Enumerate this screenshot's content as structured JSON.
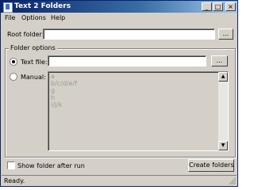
{
  "window": {
    "title": "Text 2 Folders"
  },
  "titlebar": {
    "minimize": "_",
    "maximize": "□",
    "close": "×"
  },
  "menu": {
    "file": "File",
    "options": "Options",
    "help": "Help"
  },
  "root_folder": {
    "label": "Root folder:",
    "value": "",
    "browse": "..."
  },
  "folder_options": {
    "title": "Folder options",
    "text_file": {
      "label": "Text file:",
      "value": "",
      "selected": true,
      "browse": "..."
    },
    "manual": {
      "label": "Manual:",
      "selected": false,
      "lines": [
        "a",
        "b/c/d/e/f",
        "g",
        "h",
        "i/j/k"
      ]
    }
  },
  "show_folder_after_run": {
    "label": "Show folder after run",
    "checked": false
  },
  "create_button": "Create folders",
  "status": "Ready."
}
